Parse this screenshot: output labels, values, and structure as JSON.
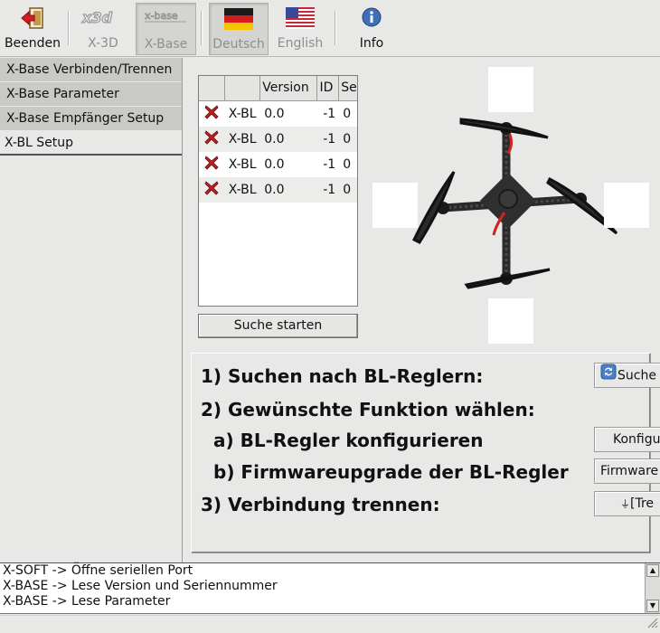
{
  "toolbar": {
    "buttons": [
      {
        "label": "Beenden",
        "icon": "exit-icon"
      },
      {
        "label": "X-3D",
        "icon": "x3d-logo-icon"
      },
      {
        "label": "X-Base",
        "icon": "xbase-logo-icon"
      },
      {
        "label": "Deutsch",
        "icon": "german-flag-icon"
      },
      {
        "label": "English",
        "icon": "us-flag-icon"
      },
      {
        "label": "Info",
        "icon": "info-icon"
      }
    ]
  },
  "sidebar": {
    "items": [
      {
        "label": "X-Base Verbinden/Trennen"
      },
      {
        "label": "X-Base Parameter"
      },
      {
        "label": "X-Base Empfänger Setup"
      },
      {
        "label": "X-BL Setup"
      }
    ]
  },
  "esc_table": {
    "columns": [
      "",
      "",
      "Version",
      "ID",
      "Se"
    ],
    "rows": [
      {
        "status_icon": "red-x-icon",
        "name": "X-BL",
        "version": "0.0",
        "id": "-1",
        "se": "0"
      },
      {
        "status_icon": "red-x-icon",
        "name": "X-BL",
        "version": "0.0",
        "id": "-1",
        "se": "0"
      },
      {
        "status_icon": "red-x-icon",
        "name": "X-BL",
        "version": "0.0",
        "id": "-1",
        "se": "0"
      },
      {
        "status_icon": "red-x-icon",
        "name": "X-BL",
        "version": "0.0",
        "id": "-1",
        "se": "0"
      }
    ],
    "search_button": "Suche starten"
  },
  "instructions": {
    "step1": "1) Suchen nach BL-Reglern:",
    "step2": "2) Gewünschte Funktion wählen:",
    "step2a": "a) BL-Regler konfigurieren",
    "step2b": "b) Firmwareupgrade der BL-Regler",
    "step3": "3) Verbindung trennen:"
  },
  "side_buttons": {
    "search": "Suche",
    "configure": "Konfigu",
    "firmware": "Firmware",
    "disconnect": "[Tre"
  },
  "log": {
    "lines": [
      "X-SOFT -> Öffne seriellen Port",
      "X-BASE -> Lese Version und Seriennummer",
      "X-BASE -> Lese Parameter"
    ]
  },
  "colors": {
    "background": "#e8e8e7",
    "error_red": "#c42020",
    "frame_dark": "#2a2a2a",
    "accent_red": "#d42020"
  }
}
